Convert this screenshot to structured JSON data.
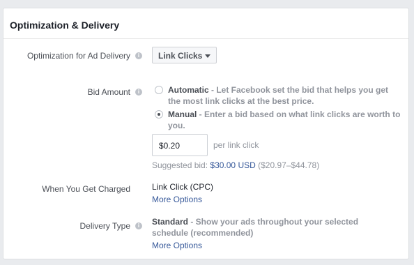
{
  "section": {
    "title": "Optimization & Delivery"
  },
  "optimization": {
    "label": "Optimization for Ad Delivery",
    "selected": "Link Clicks"
  },
  "bid_amount": {
    "label": "Bid Amount",
    "options": [
      {
        "name": "Automatic",
        "description": " - Let Facebook set the bid that helps you get the most link clicks at the best price.",
        "selected": false
      },
      {
        "name": "Manual",
        "description": " - Enter a bid based on what link clicks are worth to you.",
        "selected": true
      }
    ],
    "input_value": "$0.20",
    "unit": "per link click",
    "suggested_prefix": "Suggested bid: ",
    "suggested_amount": "$30.00 USD",
    "suggested_range": " ($20.97–$44.78)"
  },
  "charged": {
    "label": "When You Get Charged",
    "value": "Link Click (CPC)",
    "more_options": "More Options"
  },
  "delivery_type": {
    "label": "Delivery Type",
    "name": "Standard",
    "description": " - Show your ads throughout your selected schedule (recommended)",
    "more_options": "More Options"
  },
  "icons": {
    "info": "info-icon",
    "dropdown": "caret-down-icon"
  }
}
